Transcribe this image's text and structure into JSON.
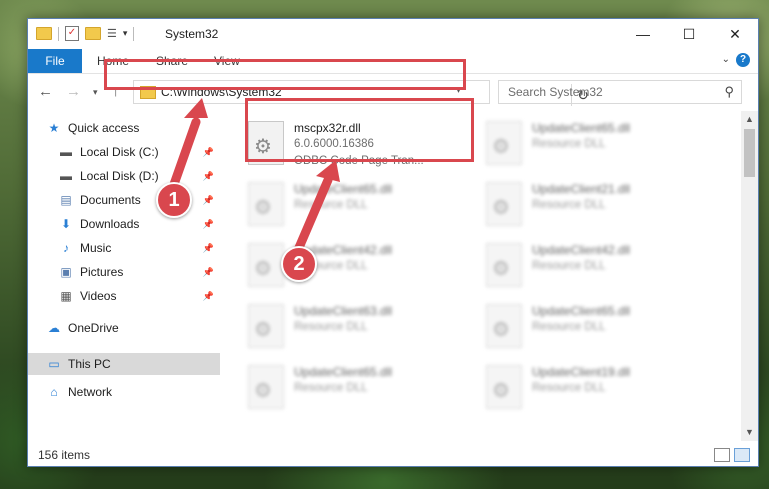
{
  "window": {
    "title": "System32",
    "controls": {
      "minimize": "—",
      "maximize": "☐",
      "close": "✕"
    }
  },
  "ribbon": {
    "tabs": [
      "File",
      "Home",
      "Share",
      "View"
    ],
    "help": "?"
  },
  "address": {
    "path": "C:\\Windows\\System32",
    "search_placeholder": "Search System32"
  },
  "sidebar": {
    "items": [
      {
        "label": "Quick access",
        "icon": "star-icon",
        "pinned": false
      },
      {
        "label": "Local Disk (C:)",
        "icon": "drive-icon",
        "pinned": true
      },
      {
        "label": "Local Disk (D:)",
        "icon": "drive-icon",
        "pinned": true
      },
      {
        "label": "Documents",
        "icon": "documents-icon",
        "pinned": true
      },
      {
        "label": "Downloads",
        "icon": "download-icon",
        "pinned": true
      },
      {
        "label": "Music",
        "icon": "music-icon",
        "pinned": true
      },
      {
        "label": "Pictures",
        "icon": "pictures-icon",
        "pinned": true
      },
      {
        "label": "Videos",
        "icon": "videos-icon",
        "pinned": true
      },
      {
        "label": "OneDrive",
        "icon": "cloud-icon",
        "pinned": false
      },
      {
        "label": "This PC",
        "icon": "computer-icon",
        "pinned": false,
        "selected": true
      },
      {
        "label": "Network",
        "icon": "network-icon",
        "pinned": false
      }
    ]
  },
  "files": {
    "highlighted": {
      "name": "mscpx32r.dll",
      "version": "6.0.6000.16386",
      "description": "ODBC Code Page Tran..."
    },
    "col1": [
      {
        "name": "UpdateClient65.dll",
        "type": "Resource DLL"
      },
      {
        "name": "UpdateClient42.dll",
        "type": "Resource DLL"
      },
      {
        "name": "UpdateClient63.dll",
        "type": "Resource DLL"
      },
      {
        "name": "UpdateClient65.dll",
        "type": "Resource DLL"
      }
    ],
    "col2": [
      {
        "name": "UpdateClient65.dll",
        "type": "Resource DLL"
      },
      {
        "name": "UpdateClient21.dll",
        "type": "Resource DLL"
      },
      {
        "name": "UpdateClient42.dll",
        "type": "Resource DLL"
      },
      {
        "name": "UpdateClient65.dll",
        "type": "Resource DLL"
      },
      {
        "name": "UpdateClient19.dll",
        "type": "Resource DLL"
      }
    ]
  },
  "status": {
    "item_count": "156 items"
  },
  "annotations": {
    "step1": "1",
    "step2": "2",
    "color": "#d9474e"
  }
}
